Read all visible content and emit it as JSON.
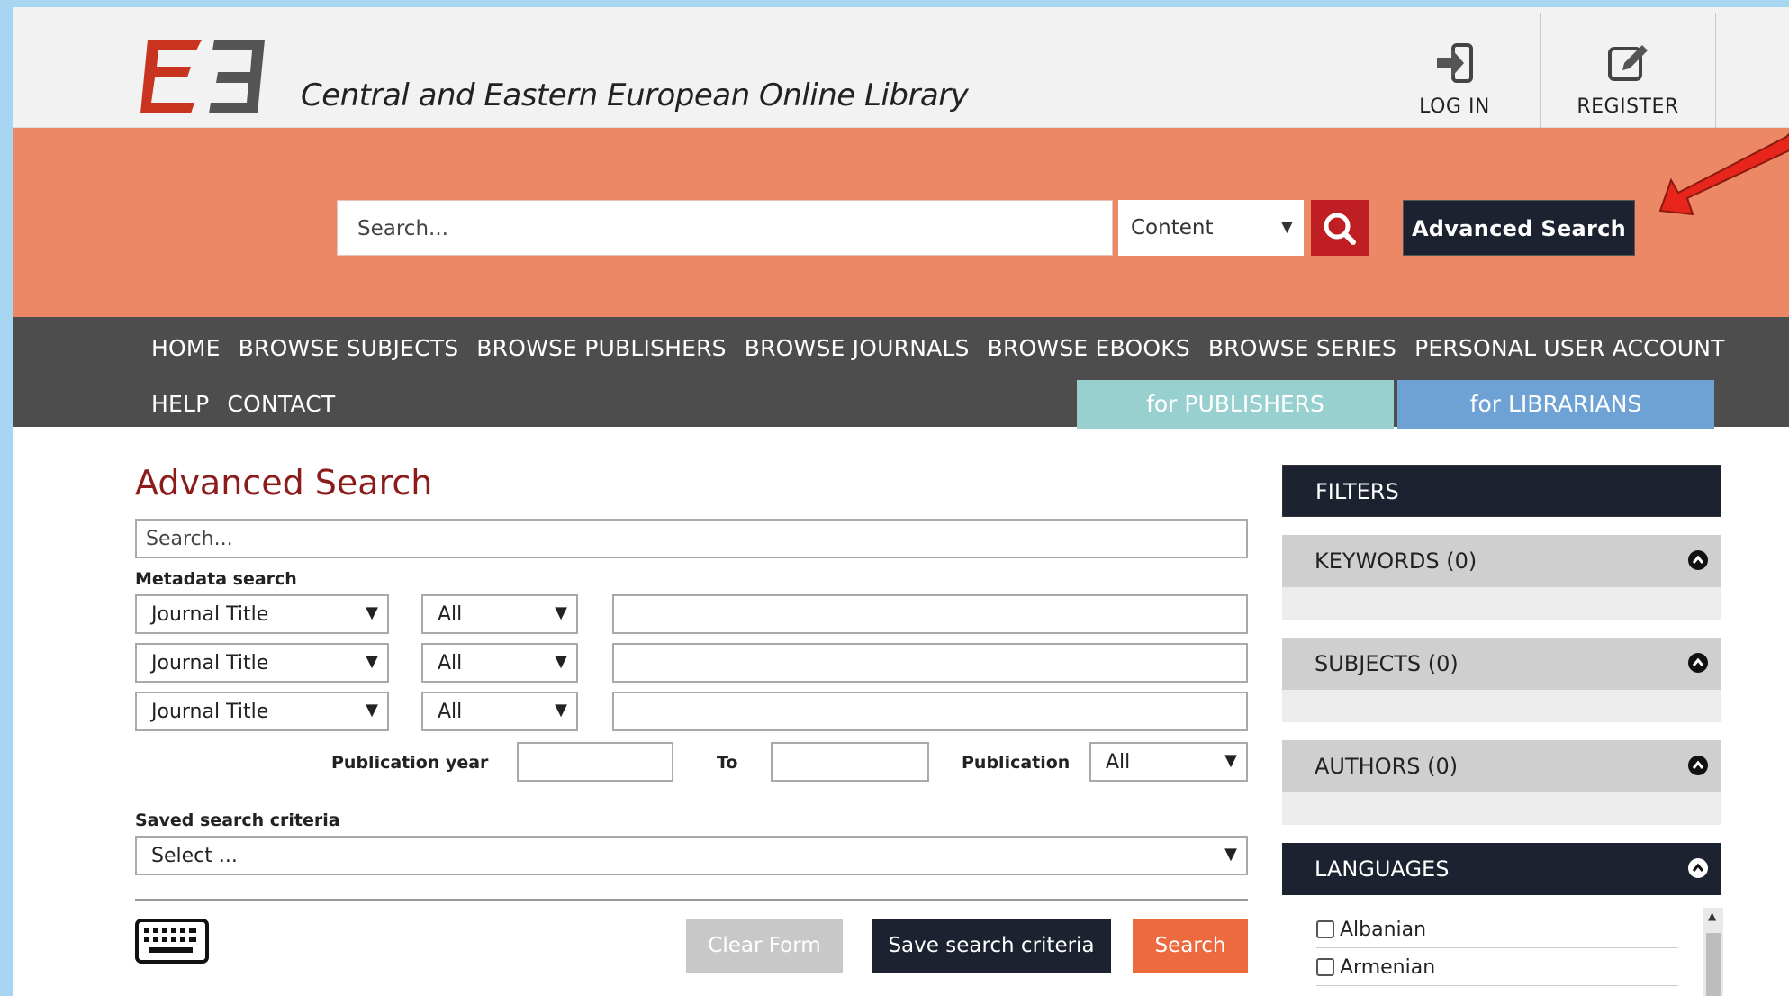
{
  "header": {
    "site_title": "Central and Eastern European Online Library",
    "login_label": "LOG IN",
    "register_label": "REGISTER"
  },
  "search_bar": {
    "placeholder": "Search...",
    "scope_value": "Content"
  },
  "advanced_search_button": "Advanced Search",
  "nav": {
    "items": [
      "HOME",
      "BROWSE SUBJECTS",
      "BROWSE PUBLISHERS",
      "BROWSE JOURNALS",
      "BROWSE EBOOKS",
      "BROWSE SERIES",
      "PERSONAL USER ACCOUNT"
    ],
    "items2": [
      "HELP",
      "CONTACT"
    ],
    "publishers_tab": "for PUBLISHERS",
    "librarians_tab": "for LIBRARIANS"
  },
  "advanced": {
    "title": "Advanced Search",
    "search_placeholder": "Search...",
    "metadata_label": "Metadata search",
    "rows": [
      {
        "field": "Journal Title",
        "operator": "All"
      },
      {
        "field": "Journal Title",
        "operator": "All"
      },
      {
        "field": "Journal Title",
        "operator": "All"
      }
    ],
    "pub_year_label": "Publication year",
    "to_label": "To",
    "publication_label": "Publication",
    "publication_value": "All",
    "saved_label": "Saved search criteria",
    "saved_value": "Select ...",
    "clear_button": "Clear Form",
    "save_button": "Save search criteria",
    "search_button": "Search"
  },
  "filters": {
    "header": "FILTERS",
    "keywords": "KEYWORDS (0)",
    "subjects": "SUBJECTS (0)",
    "authors": "AUTHORS (0)",
    "languages": "LANGUAGES",
    "language_items": [
      "Albanian",
      "Armenian"
    ]
  },
  "colors": {
    "band_orange": "#ec8865",
    "nav_dark": "#4d4d4d",
    "brand_red": "#bf1e22",
    "title_red": "#8c1b1b",
    "navy": "#1c2230",
    "publishers_teal": "#98d0cf",
    "librarians_blue": "#6fa2d4",
    "annotation_arrow": "#e8251d"
  }
}
